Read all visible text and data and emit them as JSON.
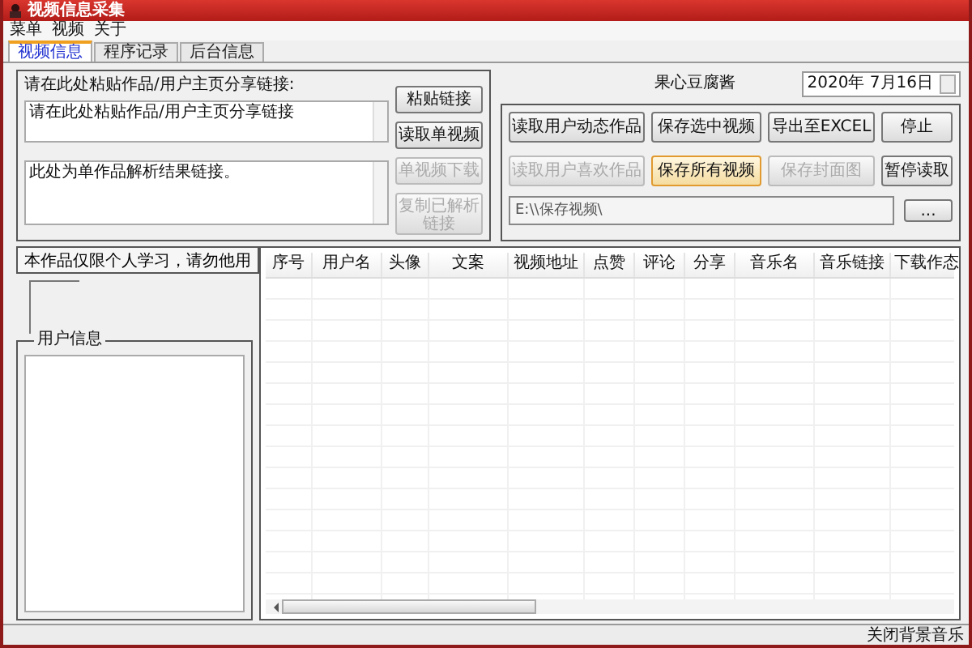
{
  "window": {
    "title": "视频信息采集"
  },
  "menu": [
    "菜单",
    "视频",
    "关于"
  ],
  "tabs": [
    {
      "label": "视频信息",
      "selected": true
    },
    {
      "label": "程序记录",
      "selected": false
    },
    {
      "label": "后台信息",
      "selected": false
    }
  ],
  "link_panel": {
    "title": "请在此处粘贴作品/用户主页分享链接:",
    "input_value": "请在此处粘贴作品/用户主页分享链接",
    "result_value": "此处为单作品解析结果链接。",
    "buttons": [
      {
        "label": "粘贴链接",
        "disabled": false
      },
      {
        "label": "读取单视频",
        "disabled": false
      },
      {
        "label": "单视频下载",
        "disabled": true
      },
      {
        "label": "复制已解析链接",
        "disabled": true
      }
    ]
  },
  "batch_panel": {
    "title": "果心豆腐酱",
    "date": "2020年 7月16日",
    "buttons": [
      {
        "label": "读取用户动态作品",
        "disabled": false,
        "focused": false
      },
      {
        "label": "保存选中视频",
        "disabled": false,
        "focused": false
      },
      {
        "label": "导出至EXCEL",
        "disabled": false,
        "focused": false
      },
      {
        "label": "停止",
        "disabled": false,
        "focused": false
      },
      {
        "label": "读取用户喜欢作品",
        "disabled": true,
        "focused": false
      },
      {
        "label": "保存所有视频",
        "disabled": false,
        "focused": true
      },
      {
        "label": "保存封面图",
        "disabled": true,
        "focused": false
      },
      {
        "label": "暂停读取",
        "disabled": false,
        "focused": false
      }
    ],
    "path_value": "E:\\\\保存视频\\",
    "browse_label": "..."
  },
  "notice_button": "本作品仅限个人学习，请勿他用",
  "user_info": {
    "title": "用户信息"
  },
  "table": {
    "columns": [
      "序号",
      "用户名",
      "头像",
      "文案",
      "视频地址",
      "点赞",
      "评论",
      "分享",
      "音乐名",
      "音乐链接",
      "下载作态"
    ]
  },
  "status_bar": {
    "text": "关闭背景音乐"
  }
}
